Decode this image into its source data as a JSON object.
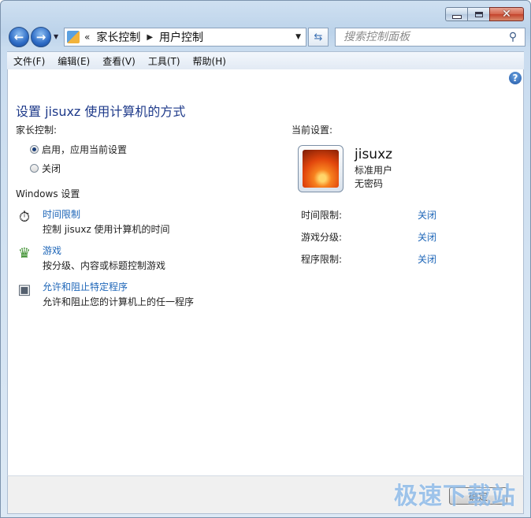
{
  "breadcrumb": {
    "chevron": "«",
    "items": [
      "家长控制",
      "用户控制"
    ]
  },
  "search": {
    "placeholder": "搜索控制面板"
  },
  "menu": [
    "文件(F)",
    "编辑(E)",
    "查看(V)",
    "工具(T)",
    "帮助(H)"
  ],
  "content": {
    "title": "设置 jisuxz 使用计算机的方式",
    "parental_label": "家长控制:",
    "radio_on": "启用，应用当前设置",
    "radio_off": "关闭",
    "radio_selected": "on",
    "windows_label": "Windows 设置",
    "tasks": [
      {
        "icon": "stopwatch-icon",
        "link": "时间限制",
        "desc": "控制 jisuxz 使用计算机的时间"
      },
      {
        "icon": "games-trophy-icon",
        "link": "游戏",
        "desc": "按分级、内容或标题控制游戏"
      },
      {
        "icon": "program-icon",
        "link": "允许和阻止特定程序",
        "desc": "允许和阻止您的计算机上的任一程序"
      }
    ],
    "current_label": "当前设置:",
    "user": {
      "name": "jisuxz",
      "type": "标准用户",
      "password": "无密码"
    },
    "settings": [
      {
        "label": "时间限制:",
        "value": "关闭"
      },
      {
        "label": "游戏分级:",
        "value": "关闭"
      },
      {
        "label": "程序限制:",
        "value": "关闭"
      }
    ]
  },
  "buttons": {
    "ok": "确定"
  },
  "watermark": "极速下载站",
  "colors": {
    "link": "#1e66b8",
    "title": "#1e3a8a",
    "accent": "#2d6bc5"
  }
}
